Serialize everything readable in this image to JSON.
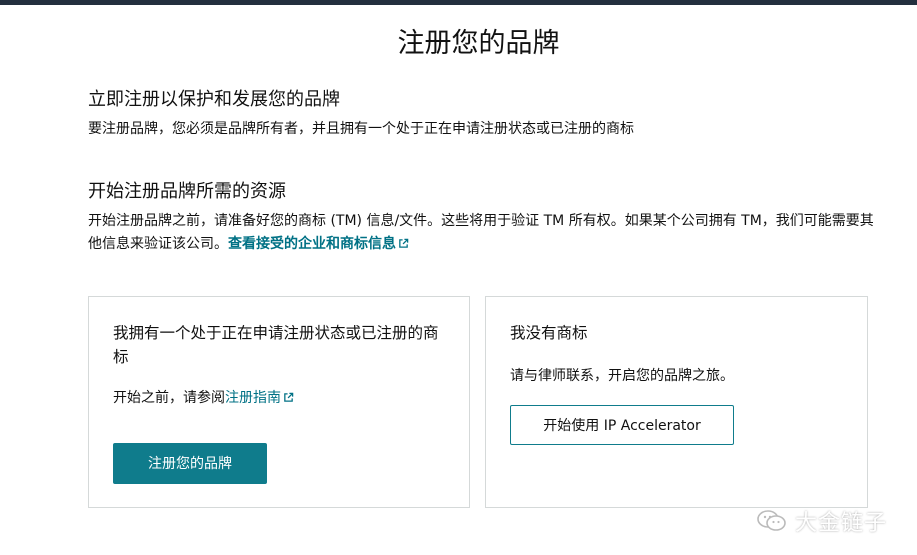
{
  "page": {
    "title": "注册您的品牌"
  },
  "intro": {
    "heading": "立即注册以保护和发展您的品牌",
    "body": "要注册品牌，您必须是品牌所有者，并且拥有一个处于正在申请注册状态或已注册的商标"
  },
  "resources": {
    "heading": "开始注册品牌所需的资源",
    "body": "开始注册品牌之前，请准备好您的商标 (TM) 信息/文件。这些将用于验证 TM 所有权。如果某个公司拥有 TM，我们可能需要其他信息来验证该公司。",
    "link_label": "查看接受的企业和商标信息"
  },
  "card_have_tm": {
    "title": "我拥有一个处于正在申请注册状态或已注册的商标",
    "text_prefix": "开始之前，请参阅",
    "guide_link": "注册指南",
    "button_label": "注册您的品牌"
  },
  "card_no_tm": {
    "title": "我没有商标",
    "text": "请与律师联系，开启您的品牌之旅。",
    "button_label": "开始使用 IP Accelerator"
  },
  "watermark": {
    "text": "大金链子",
    "icon": "wechat-icon"
  },
  "colors": {
    "topbar": "#232f3e",
    "accent": "#0f7c8c",
    "link": "#007185",
    "card_border": "#d5d9d9"
  },
  "icons": {
    "external_link": "external-link-icon"
  }
}
